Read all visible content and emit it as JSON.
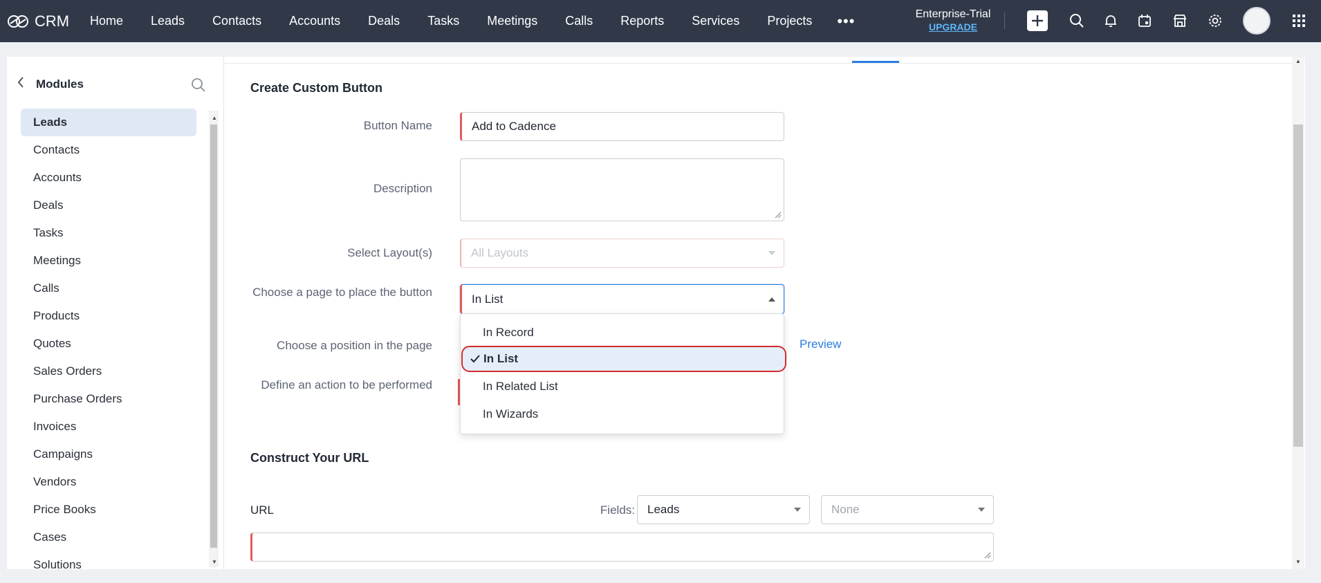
{
  "app": {
    "name": "CRM",
    "nav": [
      "Home",
      "Leads",
      "Contacts",
      "Accounts",
      "Deals",
      "Tasks",
      "Meetings",
      "Calls",
      "Reports",
      "Services",
      "Projects"
    ],
    "more": "•••",
    "edition": "Enterprise-Trial",
    "upgrade": "UPGRADE",
    "icons": [
      "plus-icon",
      "search-icon",
      "bell-icon",
      "calendar-icon",
      "store-icon",
      "settings-icon",
      "avatar",
      "apps-grid-icon"
    ]
  },
  "sidebar": {
    "title": "Modules",
    "items": [
      {
        "label": "Leads",
        "active": true
      },
      {
        "label": "Contacts"
      },
      {
        "label": "Accounts"
      },
      {
        "label": "Deals"
      },
      {
        "label": "Tasks"
      },
      {
        "label": "Meetings"
      },
      {
        "label": "Calls"
      },
      {
        "label": "Products"
      },
      {
        "label": "Quotes"
      },
      {
        "label": "Sales Orders"
      },
      {
        "label": "Purchase Orders"
      },
      {
        "label": "Invoices"
      },
      {
        "label": "Campaigns"
      },
      {
        "label": "Vendors"
      },
      {
        "label": "Price Books"
      },
      {
        "label": "Cases"
      },
      {
        "label": "Solutions"
      }
    ]
  },
  "form": {
    "section_title": "Create Custom Button",
    "button_name_label": "Button Name",
    "button_name_value": "Add to Cadence",
    "description_label": "Description",
    "description_value": "",
    "layout_label": "Select Layout(s)",
    "layout_value": "All Layouts",
    "page_label": "Choose a page to place the button",
    "page_value": "In List",
    "position_label": "Choose a position in the page",
    "preview_link": "Preview",
    "action_label": "Define an action to be performed"
  },
  "dropdown": {
    "options": [
      {
        "label": "In Record",
        "selected": false
      },
      {
        "label": "In List",
        "selected": true
      },
      {
        "label": "In Related List",
        "selected": false
      },
      {
        "label": "In Wizards",
        "selected": false
      }
    ]
  },
  "url_section": {
    "title": "Construct Your URL",
    "url_label": "URL",
    "fields_label": "Fields:",
    "module_value": "Leads",
    "field_value": "None",
    "url_value": ""
  },
  "colors": {
    "topbar": "#313949",
    "accent": "#2a7de1",
    "required": "#e25b5b",
    "highlight_border": "#d62b2b"
  }
}
